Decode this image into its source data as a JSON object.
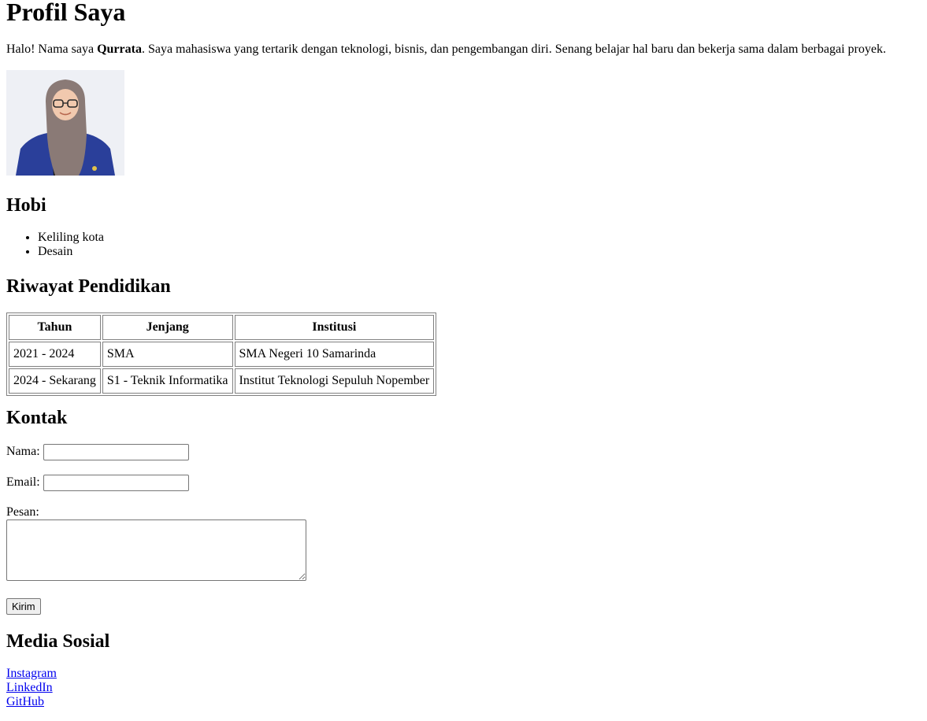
{
  "header": {
    "title": "Profil Saya"
  },
  "intro": {
    "prefix": "Halo! Nama saya ",
    "name": "Qurrata",
    "suffix": ". Saya mahasiswa yang tertarik dengan teknologi, bisnis, dan pengembangan diri. Senang belajar hal baru dan bekerja sama dalam berbagai proyek."
  },
  "hobi": {
    "title": "Hobi",
    "items": [
      "Keliling kota",
      "Desain"
    ]
  },
  "pendidikan": {
    "title": "Riwayat Pendidikan",
    "headers": [
      "Tahun",
      "Jenjang",
      "Institusi"
    ],
    "rows": [
      [
        "2021 - 2024",
        "SMA",
        "SMA Negeri 10 Samarinda"
      ],
      [
        "2024 - Sekarang",
        "S1 - Teknik Informatika",
        "Institut Teknologi Sepuluh Nopember"
      ]
    ]
  },
  "kontak": {
    "title": "Kontak",
    "nama_label": "Nama:",
    "nama_value": "",
    "email_label": "Email:",
    "email_value": "",
    "pesan_label": "Pesan:",
    "pesan_value": "",
    "submit_label": "Kirim"
  },
  "medsos": {
    "title": "Media Sosial",
    "links": [
      "Instagram",
      "LinkedIn",
      "GitHub"
    ]
  },
  "colors": {
    "link": "#0000ee",
    "jacket": "#2a3f9a",
    "hijab": "#8a7a76"
  }
}
